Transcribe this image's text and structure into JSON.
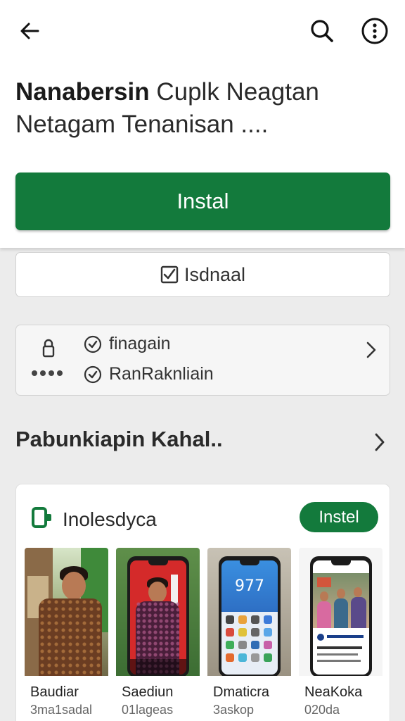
{
  "header": {
    "back_icon": "arrow-left-icon",
    "search_icon": "search-icon",
    "more_icon": "more-vert-icon"
  },
  "app": {
    "title_bold": "Nanabersin",
    "title_rest": " Cuplk Neagtan Netagam Tenanisan ...."
  },
  "actions": {
    "install_label": "Instal",
    "secondary_label": "Isdnaal"
  },
  "permissions": {
    "items": [
      {
        "label": "finagain"
      },
      {
        "label": "RanRaknliain"
      }
    ]
  },
  "section": {
    "title": "Pabunkiapin Kahal.."
  },
  "card": {
    "name": "Inolesdyca",
    "install_label": "Instel",
    "screenshots": [
      {
        "name": "Baudiar",
        "sub": "3ma1sadal"
      },
      {
        "name": "Saediun",
        "sub": "01lageas"
      },
      {
        "name": "Dmaticra",
        "sub": "3askop",
        "clock": "977"
      },
      {
        "name": "NeaKoka",
        "sub": "020da"
      }
    ]
  },
  "colors": {
    "accent_green": "#137a3c",
    "background": "#ececec",
    "surface": "#ffffff"
  }
}
